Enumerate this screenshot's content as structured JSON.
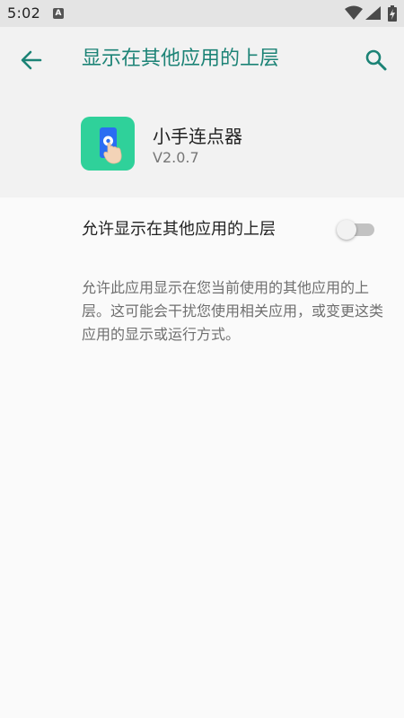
{
  "status_bar": {
    "time": "5:02",
    "notification_badge": "A",
    "icons": [
      "wifi-icon",
      "signal-icon",
      "battery-charging-icon"
    ]
  },
  "app_bar": {
    "title": "显示在其他应用的上层",
    "back_icon": "arrow-left-icon",
    "search_icon": "search-icon",
    "accent_color": "#1c8376"
  },
  "app_info": {
    "name": "小手连点器",
    "version": "V2.0.7",
    "icon": "tap-hand-app-icon",
    "icon_color": "#2fd19a"
  },
  "permission": {
    "label": "允许显示在其他应用的上层",
    "enabled": false
  },
  "description": "允许此应用显示在您当前使用的其他应用的上层。这可能会干扰您使用相关应用，或变更这类应用的显示或运行方式。"
}
